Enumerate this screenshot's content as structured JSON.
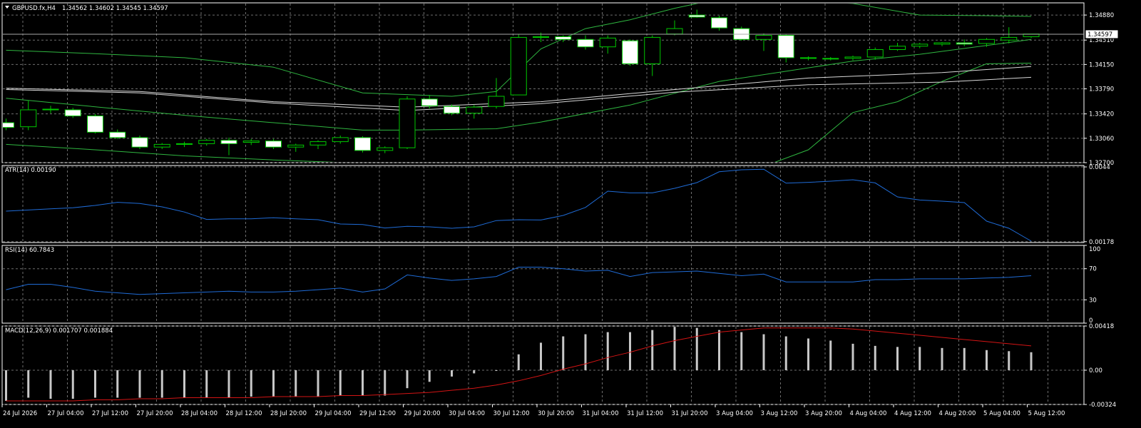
{
  "colors": {
    "background": "#000000",
    "grid": "#6e6e6e",
    "frame": "#ffffff",
    "bull_candle": "#00c800",
    "bear_fill": "#ffffff",
    "band": "#2fb640",
    "ma": "#d8d8d8",
    "atr": "#1f6bd6",
    "rsi": "#1f6bd6",
    "macd_signal": "#d41414",
    "macd_hist": "#c8c8c8",
    "price_line": "#a8a8a8"
  },
  "symbol": {
    "name": "GBPUSD.fx,H4",
    "ohlc": "1.34562 1.34602 1.34545 1.34597",
    "current_price": "1.34597"
  },
  "chart_data": [
    {
      "type": "candlestick",
      "title": "GBPUSD.fx,H4",
      "y_ticks": [
        "1.34880",
        "1.34510",
        "1.34150",
        "1.33790",
        "1.33420",
        "1.33060",
        "1.32700"
      ],
      "ylim": [
        1.327,
        1.3506
      ],
      "grid": true,
      "candles": [
        {
          "o": 1.3329,
          "h": 1.3335,
          "l": 1.3318,
          "c": 1.3322
        },
        {
          "o": 1.3323,
          "h": 1.3362,
          "l": 1.3318,
          "c": 1.3348
        },
        {
          "o": 1.3348,
          "h": 1.3354,
          "l": 1.3343,
          "c": 1.3349
        },
        {
          "o": 1.3348,
          "h": 1.3351,
          "l": 1.3336,
          "c": 1.3339
        },
        {
          "o": 1.3339,
          "h": 1.3342,
          "l": 1.3313,
          "c": 1.3315
        },
        {
          "o": 1.3315,
          "h": 1.3319,
          "l": 1.3305,
          "c": 1.3307
        },
        {
          "o": 1.3307,
          "h": 1.331,
          "l": 1.329,
          "c": 1.3293
        },
        {
          "o": 1.3293,
          "h": 1.3299,
          "l": 1.329,
          "c": 1.3297
        },
        {
          "o": 1.3297,
          "h": 1.3301,
          "l": 1.3293,
          "c": 1.3298
        },
        {
          "o": 1.3298,
          "h": 1.3305,
          "l": 1.3295,
          "c": 1.3303
        },
        {
          "o": 1.3303,
          "h": 1.3307,
          "l": 1.3281,
          "c": 1.3298
        },
        {
          "o": 1.33,
          "h": 1.3305,
          "l": 1.3296,
          "c": 1.3302
        },
        {
          "o": 1.3302,
          "h": 1.3305,
          "l": 1.329,
          "c": 1.3293
        },
        {
          "o": 1.3293,
          "h": 1.3298,
          "l": 1.3286,
          "c": 1.3296
        },
        {
          "o": 1.3296,
          "h": 1.3303,
          "l": 1.329,
          "c": 1.3301
        },
        {
          "o": 1.3301,
          "h": 1.331,
          "l": 1.3298,
          "c": 1.3307
        },
        {
          "o": 1.3307,
          "h": 1.3309,
          "l": 1.3285,
          "c": 1.3288
        },
        {
          "o": 1.3288,
          "h": 1.3294,
          "l": 1.3284,
          "c": 1.3292
        },
        {
          "o": 1.3292,
          "h": 1.3368,
          "l": 1.329,
          "c": 1.3364
        },
        {
          "o": 1.3364,
          "h": 1.337,
          "l": 1.335,
          "c": 1.3354
        },
        {
          "o": 1.3353,
          "h": 1.3356,
          "l": 1.334,
          "c": 1.3343
        },
        {
          "o": 1.3343,
          "h": 1.3355,
          "l": 1.3335,
          "c": 1.3352
        },
        {
          "o": 1.3353,
          "h": 1.3395,
          "l": 1.335,
          "c": 1.3368
        },
        {
          "o": 1.337,
          "h": 1.346,
          "l": 1.337,
          "c": 1.3455
        },
        {
          "o": 1.3455,
          "h": 1.3462,
          "l": 1.3448,
          "c": 1.3456
        },
        {
          "o": 1.3456,
          "h": 1.3458,
          "l": 1.3448,
          "c": 1.3452
        },
        {
          "o": 1.3452,
          "h": 1.3458,
          "l": 1.3437,
          "c": 1.3441
        },
        {
          "o": 1.3441,
          "h": 1.3458,
          "l": 1.3431,
          "c": 1.3454
        },
        {
          "o": 1.345,
          "h": 1.3452,
          "l": 1.3413,
          "c": 1.3416
        },
        {
          "o": 1.3416,
          "h": 1.3458,
          "l": 1.3398,
          "c": 1.3455
        },
        {
          "o": 1.346,
          "h": 1.348,
          "l": 1.3458,
          "c": 1.3468
        },
        {
          "o": 1.3488,
          "h": 1.3496,
          "l": 1.3484,
          "c": 1.3485
        },
        {
          "o": 1.3484,
          "h": 1.3487,
          "l": 1.3465,
          "c": 1.3469
        },
        {
          "o": 1.3468,
          "h": 1.3471,
          "l": 1.345,
          "c": 1.3452
        },
        {
          "o": 1.3452,
          "h": 1.3461,
          "l": 1.3435,
          "c": 1.3458
        },
        {
          "o": 1.3458,
          "h": 1.346,
          "l": 1.3418,
          "c": 1.3425
        },
        {
          "o": 1.3425,
          "h": 1.3427,
          "l": 1.3421,
          "c": 1.3424
        },
        {
          "o": 1.3423,
          "h": 1.3426,
          "l": 1.3421,
          "c": 1.3424
        },
        {
          "o": 1.3424,
          "h": 1.3428,
          "l": 1.3421,
          "c": 1.3426
        },
        {
          "o": 1.3426,
          "h": 1.344,
          "l": 1.3422,
          "c": 1.3437
        },
        {
          "o": 1.3437,
          "h": 1.3447,
          "l": 1.3435,
          "c": 1.3442
        },
        {
          "o": 1.3442,
          "h": 1.3447,
          "l": 1.3439,
          "c": 1.3445
        },
        {
          "o": 1.3445,
          "h": 1.3448,
          "l": 1.3442,
          "c": 1.3447
        },
        {
          "o": 1.3447,
          "h": 1.3452,
          "l": 1.3442,
          "c": 1.3445
        },
        {
          "o": 1.3446,
          "h": 1.3454,
          "l": 1.3441,
          "c": 1.3452
        },
        {
          "o": 1.3451,
          "h": 1.347,
          "l": 1.3446,
          "c": 1.3455
        },
        {
          "o": 1.3456,
          "h": 1.346,
          "l": 1.3454,
          "c": 1.346
        }
      ],
      "bollinger_upper": [
        [
          0,
          1.3436
        ],
        [
          4,
          1.3431
        ],
        [
          8,
          1.3425
        ],
        [
          12,
          1.3411
        ],
        [
          16,
          1.3373
        ],
        [
          20,
          1.3368
        ],
        [
          22,
          1.3375
        ],
        [
          24,
          1.3438
        ],
        [
          26,
          1.3468
        ],
        [
          28,
          1.3481
        ],
        [
          30,
          1.3498
        ],
        [
          32,
          1.3512
        ],
        [
          35,
          1.351
        ],
        [
          38,
          1.3505
        ],
        [
          41,
          1.3488
        ],
        [
          44,
          1.3487
        ],
        [
          46,
          1.3486
        ]
      ],
      "bollinger_middle": [
        [
          0,
          1.3365
        ],
        [
          8,
          1.334
        ],
        [
          16,
          1.3318
        ],
        [
          18,
          1.3318
        ],
        [
          22,
          1.332
        ],
        [
          24,
          1.333
        ],
        [
          28,
          1.3355
        ],
        [
          32,
          1.339
        ],
        [
          35,
          1.3405
        ],
        [
          38,
          1.342
        ],
        [
          41,
          1.343
        ],
        [
          44,
          1.3443
        ],
        [
          46,
          1.3452
        ]
      ],
      "bollinger_lower": [
        [
          0,
          1.3297
        ],
        [
          4,
          1.3289
        ],
        [
          8,
          1.328
        ],
        [
          12,
          1.3274
        ],
        [
          16,
          1.3269
        ],
        [
          20,
          1.3262
        ],
        [
          24,
          1.3224
        ],
        [
          28,
          1.3226
        ],
        [
          32,
          1.324
        ],
        [
          36,
          1.3289
        ],
        [
          38,
          1.3344
        ],
        [
          40,
          1.336
        ],
        [
          42,
          1.339
        ],
        [
          44,
          1.3416
        ],
        [
          46,
          1.3417
        ]
      ],
      "ma_fast": [
        [
          0,
          1.338
        ],
        [
          6,
          1.3375
        ],
        [
          12,
          1.336
        ],
        [
          18,
          1.3352
        ],
        [
          24,
          1.336
        ],
        [
          30,
          1.3378
        ],
        [
          36,
          1.3395
        ],
        [
          42,
          1.3403
        ],
        [
          46,
          1.3412
        ]
      ],
      "ma_slow": [
        [
          0,
          1.3378
        ],
        [
          6,
          1.3373
        ],
        [
          12,
          1.3358
        ],
        [
          18,
          1.3347
        ],
        [
          24,
          1.3357
        ],
        [
          30,
          1.3374
        ],
        [
          36,
          1.3385
        ],
        [
          42,
          1.3389
        ],
        [
          46,
          1.3396
        ]
      ]
    },
    {
      "type": "line",
      "title": "ATR(14) 0.00190",
      "y_ticks": [
        "0.0044",
        "0.00178"
      ],
      "ylim": [
        0.00175,
        0.00445
      ],
      "grid": true,
      "values": [
        0.00285,
        0.00289,
        0.00293,
        0.00297,
        0.00305,
        0.00316,
        0.00312,
        0.003,
        0.00282,
        0.00256,
        0.00258,
        0.00258,
        0.00262,
        0.00258,
        0.00255,
        0.0024,
        0.00238,
        0.00226,
        0.00232,
        0.0023,
        0.00225,
        0.0023,
        0.00252,
        0.00255,
        0.00254,
        0.0027,
        0.00298,
        0.00355,
        0.00349,
        0.00349,
        0.00365,
        0.00385,
        0.00423,
        0.0043,
        0.00432,
        0.00383,
        0.00386,
        0.0039,
        0.00395,
        0.00384,
        0.00335,
        0.00324,
        0.0032,
        0.00315,
        0.0025,
        0.00225,
        0.0018
      ]
    },
    {
      "type": "line",
      "title": "RSI(14) 60.7843",
      "y_ticks": [
        "100",
        "70",
        "30",
        "0"
      ],
      "ylim": [
        0,
        100
      ],
      "grid": true,
      "values": [
        43,
        50,
        50,
        46,
        41,
        39,
        37,
        38,
        39,
        40,
        41,
        40,
        40,
        41,
        43,
        45,
        40,
        44,
        62,
        58,
        55,
        57,
        60,
        72,
        72,
        70,
        67,
        68,
        60,
        65,
        66,
        67,
        64,
        61,
        63,
        53,
        53,
        53,
        53,
        56,
        56,
        57,
        57,
        57,
        58,
        59,
        61
      ]
    },
    {
      "type": "bar",
      "title": "MACD(12,26,9) 0.001707 0.001884",
      "y_ticks": [
        "0.00418",
        "0.00",
        "-0.00324"
      ],
      "ylim": [
        -0.00324,
        0.00418
      ],
      "grid": true,
      "macd": [
        -0.0029,
        -0.0026,
        -0.0027,
        -0.0027,
        -0.0026,
        -0.0026,
        -0.0026,
        -0.0026,
        -0.0026,
        -0.0026,
        -0.0026,
        -0.0025,
        -0.0025,
        -0.0025,
        -0.0025,
        -0.0024,
        -0.0024,
        -0.0024,
        -0.0017,
        -0.0011,
        -0.0006,
        -0.0003,
        0.0,
        0.0015,
        0.0026,
        0.0032,
        0.0034,
        0.0036,
        0.0036,
        0.0038,
        0.0041,
        0.004,
        0.0038,
        0.0036,
        0.0034,
        0.0032,
        0.003,
        0.0028,
        0.0025,
        0.0023,
        0.0022,
        0.0022,
        0.0021,
        0.0021,
        0.0019,
        0.0018,
        0.0017
      ],
      "signal": [
        -0.0029,
        -0.0029,
        -0.0029,
        -0.0029,
        -0.0028,
        -0.0028,
        -0.0027,
        -0.0027,
        -0.0026,
        -0.0026,
        -0.0026,
        -0.0026,
        -0.0025,
        -0.0025,
        -0.0025,
        -0.0024,
        -0.0024,
        -0.0023,
        -0.0022,
        -0.0021,
        -0.0019,
        -0.0017,
        -0.0014,
        -0.001,
        -0.0005,
        0.0001,
        0.0006,
        0.0012,
        0.0017,
        0.0023,
        0.0028,
        0.0032,
        0.0036,
        0.0038,
        0.004,
        0.004,
        0.004,
        0.004,
        0.0039,
        0.0037,
        0.0035,
        0.0033,
        0.0031,
        0.0029,
        0.0027,
        0.0025,
        0.0023
      ]
    }
  ],
  "time_axis": {
    "labels": [
      "24 Jul 2026",
      "27 Jul 04:00",
      "27 Jul 12:00",
      "27 Jul 20:00",
      "28 Jul 04:00",
      "28 Jul 12:00",
      "28 Jul 20:00",
      "29 Jul 04:00",
      "29 Jul 12:00",
      "29 Jul 20:00",
      "30 Jul 04:00",
      "30 Jul 12:00",
      "30 Jul 20:00",
      "31 Jul 04:00",
      "31 Jul 12:00",
      "31 Jul 20:00",
      "3 Aug 04:00",
      "3 Aug 12:00",
      "3 Aug 20:00",
      "4 Aug 04:00",
      "4 Aug 12:00",
      "4 Aug 20:00",
      "5 Aug 04:00",
      "5 Aug 12:00"
    ]
  }
}
